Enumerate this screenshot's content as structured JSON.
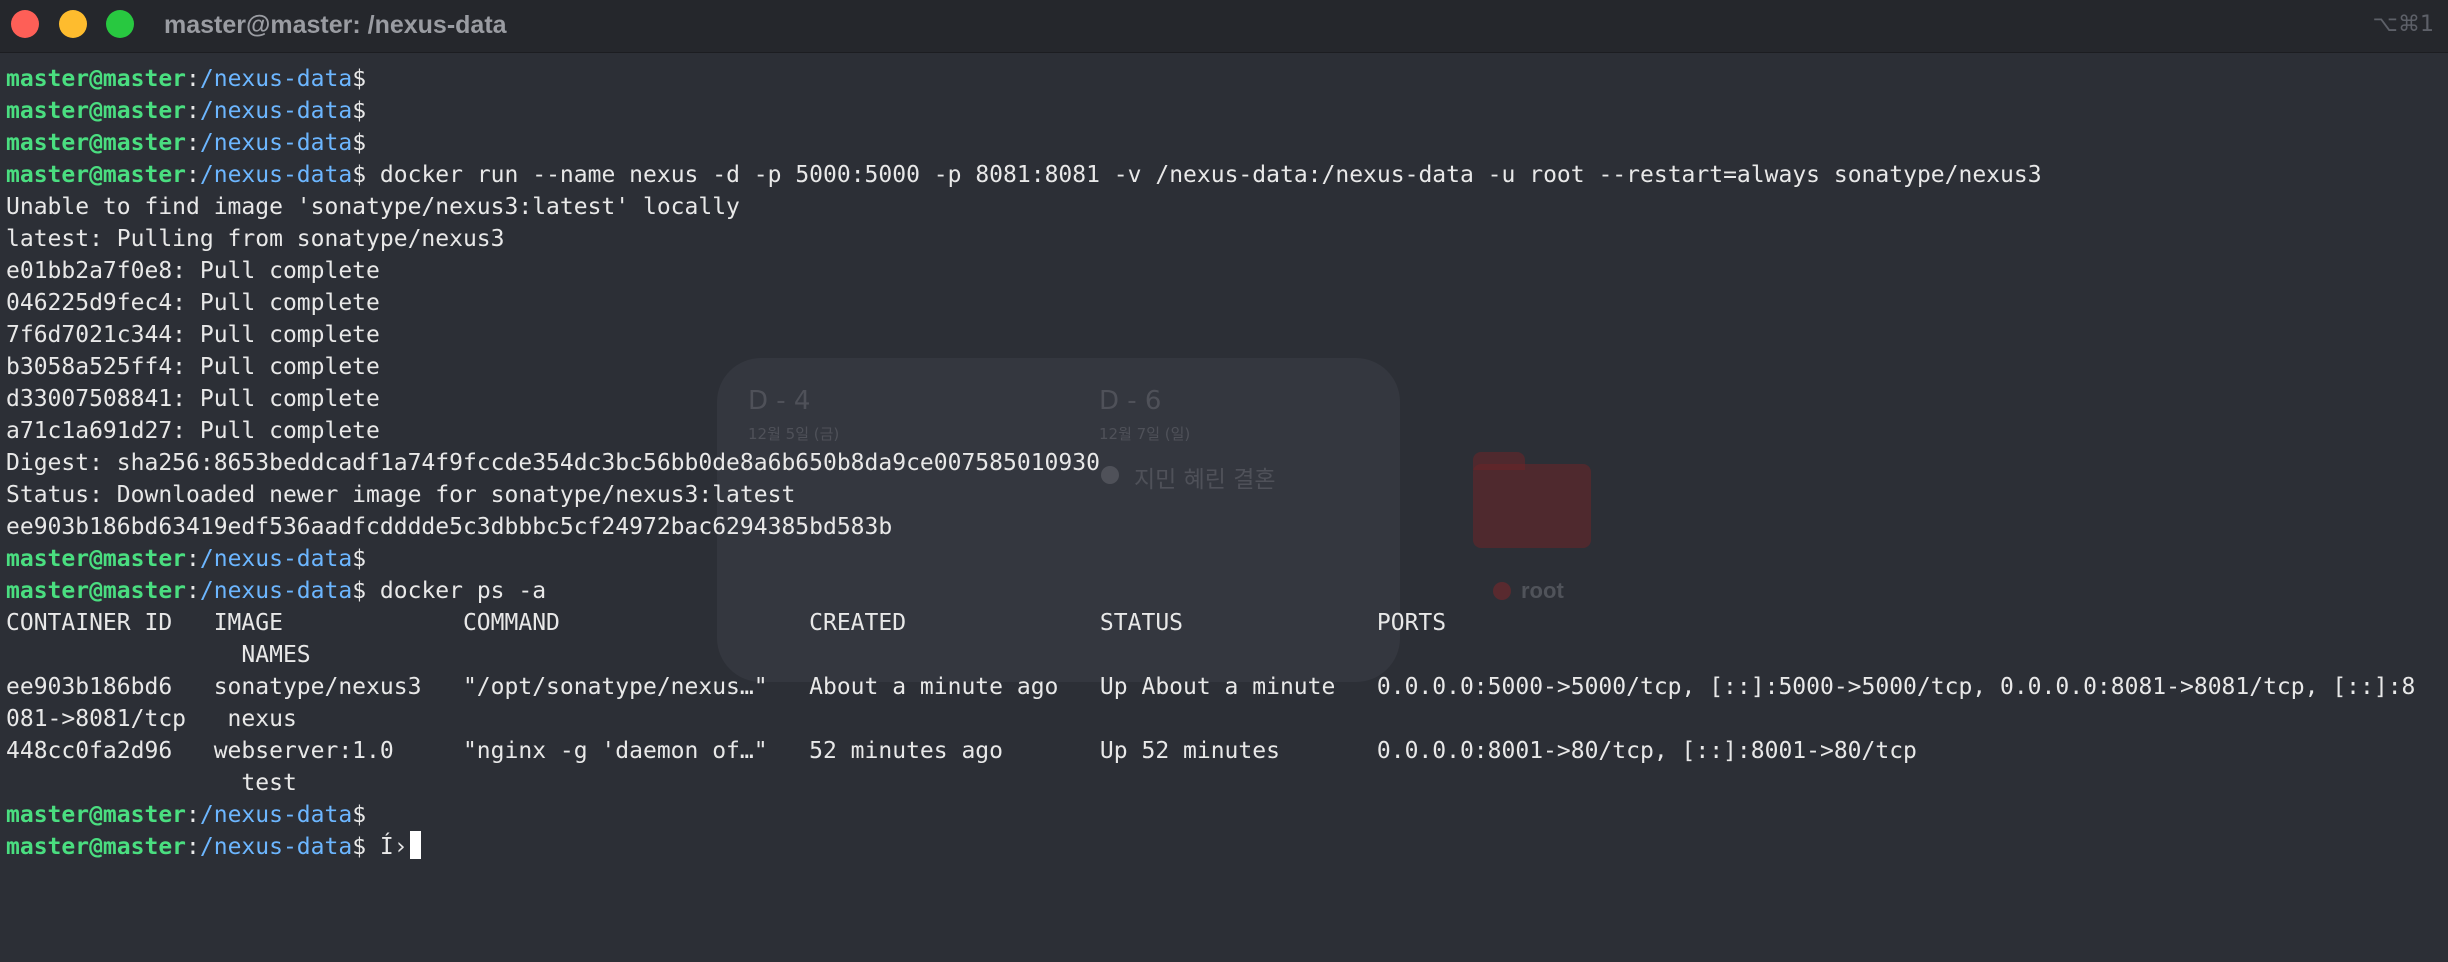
{
  "window": {
    "title": "master@master: /nexus-data",
    "shortcut": "⌥⌘1"
  },
  "prompt": {
    "user": "master@master",
    "sep": ":",
    "path": "/nexus-data",
    "symbol": "$"
  },
  "background_widgets": {
    "d_day_1": {
      "label": "D - 4",
      "date": "12월 5일 (금)",
      "event": ""
    },
    "d_day_2": {
      "label": "D - 6",
      "date": "12월 7일 (일)",
      "event": "지민 혜린 결혼"
    },
    "folder_label": "root"
  },
  "terminal": {
    "lines": [
      {
        "prompt": true,
        "cmd": ""
      },
      {
        "prompt": true,
        "cmd": ""
      },
      {
        "prompt": true,
        "cmd": ""
      },
      {
        "prompt": true,
        "cmd": " docker run --name nexus -d -p 5000:5000 -p 8081:8081 -v /nexus-data:/nexus-data -u root --restart=always sonatype/nexus3"
      },
      {
        "text": "Unable to find image 'sonatype/nexus3:latest' locally"
      },
      {
        "text": "latest: Pulling from sonatype/nexus3"
      },
      {
        "text": "e01bb2a7f0e8: Pull complete"
      },
      {
        "text": "046225d9fec4: Pull complete"
      },
      {
        "text": "7f6d7021c344: Pull complete"
      },
      {
        "text": "b3058a525ff4: Pull complete"
      },
      {
        "text": "d33007508841: Pull complete"
      },
      {
        "text": "a71c1a691d27: Pull complete"
      },
      {
        "text": "Digest: sha256:8653beddcadf1a74f9fccde354dc3bc56bb0de8a6b650b8da9ce007585010930"
      },
      {
        "text": "Status: Downloaded newer image for sonatype/nexus3:latest"
      },
      {
        "text": "ee903b186bd63419edf536aadfcdddde5c3dbbbc5cf24972bac6294385bd583b"
      },
      {
        "prompt": true,
        "cmd": ""
      },
      {
        "prompt": true,
        "cmd": " docker ps -a"
      },
      {
        "text": "CONTAINER ID   IMAGE             COMMAND                  CREATED              STATUS              PORTS"
      },
      {
        "text": "                 NAMES"
      },
      {
        "text": "ee903b186bd6   sonatype/nexus3   \"/opt/sonatype/nexus…\"   About a minute ago   Up About a minute   0.0.0.0:5000->5000/tcp, [::]:5000->5000/tcp, 0.0.0.0:8081->8081/tcp, [::]:8"
      },
      {
        "text": "081->8081/tcp   nexus"
      },
      {
        "text": "448cc0fa2d96   webserver:1.0     \"nginx -g 'daemon of…\"   52 minutes ago       Up 52 minutes       0.0.0.0:8001->80/tcp, [::]:8001->80/tcp"
      },
      {
        "text": "                 test"
      },
      {
        "prompt": true,
        "cmd": ""
      },
      {
        "prompt": true,
        "cmd": " Í›",
        "cursor": true
      }
    ]
  },
  "colors": {
    "prompt_user": "#4ade80",
    "prompt_path": "#6cb6ff",
    "background": "#2c2f36",
    "text": "#e8e8e8"
  }
}
